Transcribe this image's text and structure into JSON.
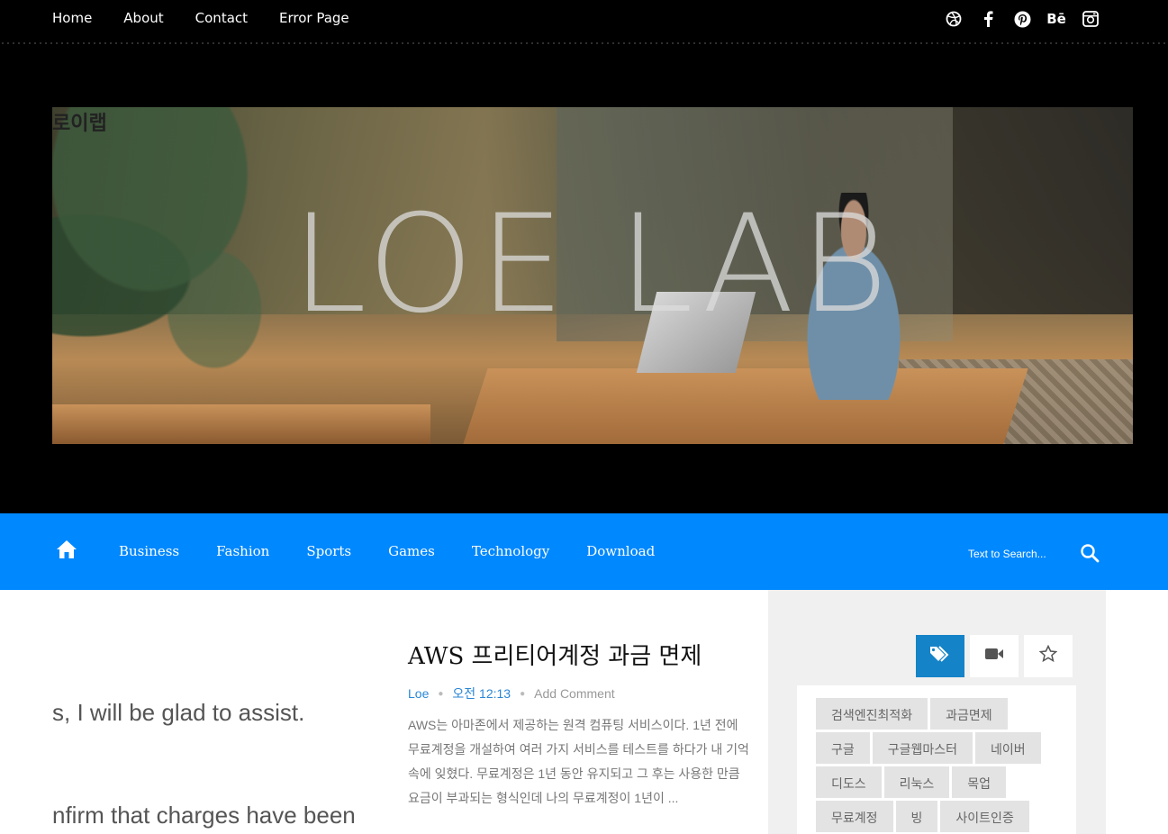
{
  "top_nav": {
    "links": [
      "Home",
      "About",
      "Contact",
      "Error Page"
    ]
  },
  "social_icons": [
    "dribbble-icon",
    "facebook-icon",
    "pinterest-icon",
    "behance-icon",
    "instagram-icon"
  ],
  "header": {
    "site_name": "로이랩",
    "banner_title": "LOE LAB"
  },
  "main_nav": {
    "links": [
      "Business",
      "Fashion",
      "Sports",
      "Games",
      "Technology",
      "Download"
    ],
    "search_placeholder": "Text to Search..."
  },
  "post": {
    "thumb_line1": "s, I will be glad to assist.",
    "thumb_line2": "nfirm that charges have been",
    "title": "AWS 프리티어계정 과금 면제",
    "author": "Loe",
    "time": "오전 12:13",
    "comment": "Add Comment",
    "excerpt": "AWS는 아마존에서 제공하는 원격 컴퓨팅 서비스이다. 1년 전에 무료계정을 개설하여 여러 가지 서비스를 테스트를 하다가 내 기억 속에 잊혔다. 무료계정은 1년 동안 유지되고 그 후는 사용한 만큼 요금이 부과되는 형식인데 나의 무료계정이 1년이 ..."
  },
  "sidebar": {
    "tags": [
      "검색엔진최적화",
      "과금면제",
      "구글",
      "구글웹마스터",
      "네이버",
      "디도스",
      "리눅스",
      "목업",
      "무료계정",
      "빙",
      "사이트인증"
    ]
  },
  "colors": {
    "nav_blue": "#0088ff",
    "tab_active": "#1583c8"
  }
}
